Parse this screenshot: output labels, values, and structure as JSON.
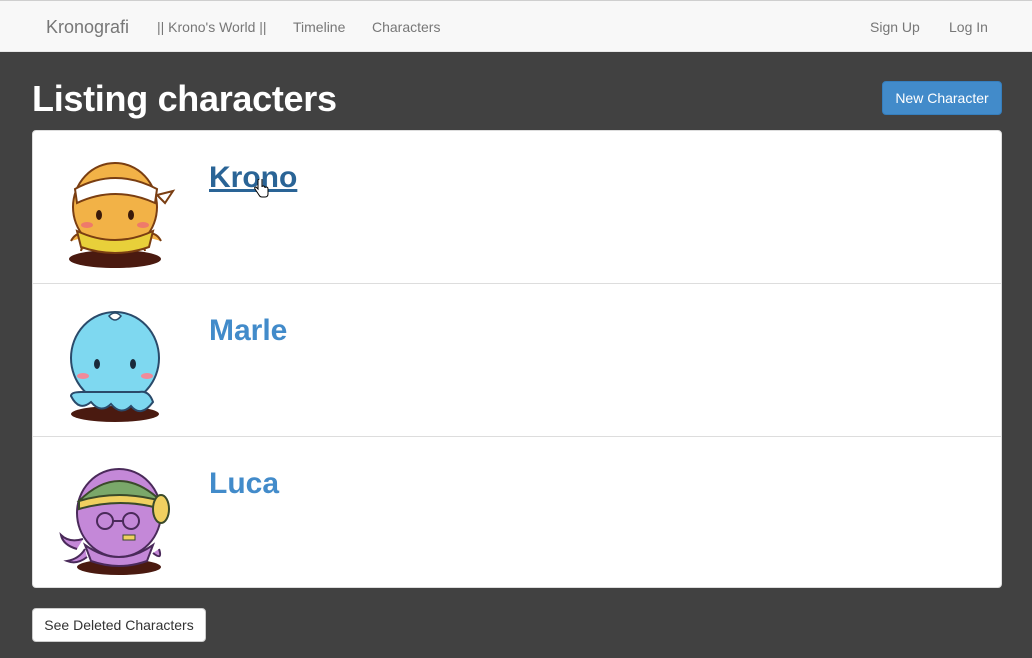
{
  "navbar": {
    "brand": "Kronografi",
    "links": [
      "|| Krono's World ||",
      "Timeline",
      "Characters"
    ],
    "right_links": [
      "Sign Up",
      "Log In"
    ]
  },
  "page": {
    "title": "Listing characters",
    "new_button": "New Character",
    "deleted_button": "See Deleted Characters"
  },
  "characters": [
    {
      "name": "Krono",
      "avatar": "krono-octopus-icon"
    },
    {
      "name": "Marle",
      "avatar": "marle-octopus-icon"
    },
    {
      "name": "Luca",
      "avatar": "luca-octopus-icon"
    }
  ],
  "colors": {
    "background": "#414141",
    "navbar": "#f8f8f8",
    "primary": "#428bca",
    "link_hover": "#2a6496"
  }
}
